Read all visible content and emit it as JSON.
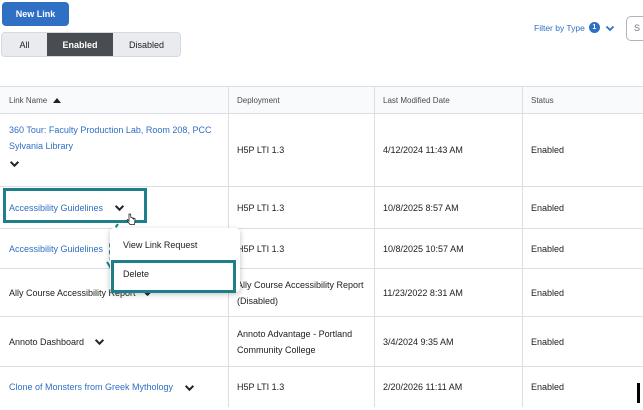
{
  "toolbar": {
    "new_link_label": "New Link",
    "filter_label": "Filter by Type",
    "filter_count": "1",
    "search_partial": "S"
  },
  "segment": {
    "all": "All",
    "enabled": "Enabled",
    "disabled": "Disabled",
    "selected": "Enabled"
  },
  "table": {
    "headers": {
      "name": "Link Name",
      "deployment": "Deployment",
      "modified": "Last Modified Date",
      "status": "Status"
    },
    "rows": [
      {
        "name": "360 Tour: Faculty Production Lab, Room 208, PCC Sylvania Library",
        "deployment": "H5P LTI 1.3",
        "modified": "4/12/2024 11:43 AM",
        "status": "Enabled"
      },
      {
        "name": "Accessibility Guidelines",
        "deployment": "H5P LTI 1.3",
        "modified": "10/8/2025 8:57 AM",
        "status": "Enabled"
      },
      {
        "name": "Accessibility Guidelines",
        "deployment": "H5P LTI 1.3",
        "modified": "10/8/2025 10:57 AM",
        "status": "Enabled"
      },
      {
        "name": "Ally Course Accessibility Report",
        "deployment": "Ally Course Accessibility Report (Disabled)",
        "modified": "11/23/2022 8:31 AM",
        "status": "Enabled"
      },
      {
        "name": "Annoto Dashboard",
        "deployment": "Annoto Advantage - Portland Community College",
        "modified": "3/4/2024 9:35 AM",
        "status": "Enabled"
      },
      {
        "name": "Clone of Monsters from Greek Mythology",
        "deployment": "H5P LTI 1.3",
        "modified": "2/20/2026 11:11 AM",
        "status": "Enabled"
      }
    ]
  },
  "context_menu": {
    "view_link_request": "View Link Request",
    "delete": "Delete"
  },
  "colors": {
    "primary": "#2f6fc4",
    "highlight": "#1e7f8a",
    "active_segment": "#494c50"
  }
}
